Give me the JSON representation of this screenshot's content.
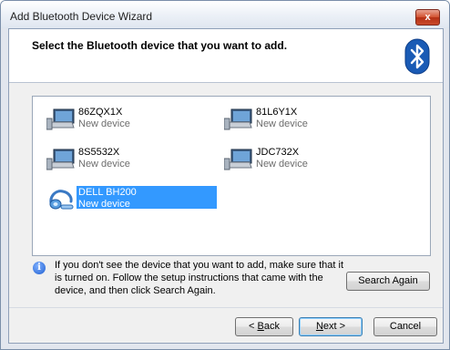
{
  "window": {
    "title": "Add Bluetooth Device Wizard",
    "close_label": "x"
  },
  "header": {
    "heading": "Select the Bluetooth device that you want to add."
  },
  "devices": [
    {
      "name": "86ZQX1X",
      "status": "New device",
      "icon": "computer-icon"
    },
    {
      "name": "81L6Y1X",
      "status": "New device",
      "icon": "computer-icon"
    },
    {
      "name": "8S5532X",
      "status": "New device",
      "icon": "computer-icon"
    },
    {
      "name": "JDC732X",
      "status": "New device",
      "icon": "computer-icon"
    },
    {
      "name": "DELL BH200",
      "status": "New device",
      "icon": "headset-icon",
      "selected": true
    }
  ],
  "info": {
    "text": "If you don't see the device that you want to add, make sure that it is turned on. Follow the setup instructions that came with the device, and then click Search Again."
  },
  "buttons": {
    "search_again": "Search Again",
    "back_prefix": "< ",
    "back_key": "B",
    "back_rest": "ack",
    "next_key": "N",
    "next_rest": "ext >",
    "cancel": "Cancel"
  },
  "colors": {
    "selection": "#3399ff",
    "bluetooth_blue": "#1a5bb5"
  }
}
